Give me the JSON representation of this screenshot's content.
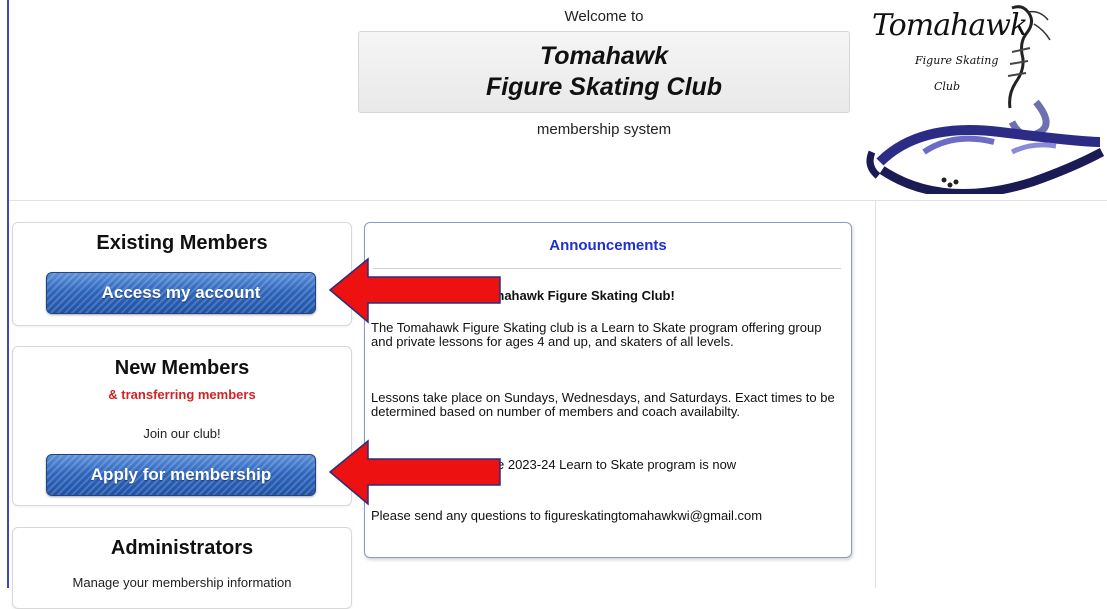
{
  "header": {
    "welcome": "Welcome to",
    "title_line1": "Tomahawk",
    "title_line2": "Figure Skating Club",
    "subtitle": "membership system"
  },
  "logo": {
    "word": "Tomahawk",
    "line2": "Figure Skating",
    "line3": "Club"
  },
  "existing": {
    "heading": "Existing Members",
    "button": "Access my account"
  },
  "new_members": {
    "heading": "New Members",
    "subheading": "& transferring members",
    "text": "Join our club!",
    "button": "Apply for membership"
  },
  "admin": {
    "heading": "Administrators",
    "text": "Manage your membership information"
  },
  "announcements": {
    "title": "Announcements",
    "welcome_line": "e Tomahawk Figure Skating Club!",
    "p1": "The Tomahawk Figure Skating club is a Learn to Skate program offering group and private lessons for ages 4 and up, and skaters of all levels.",
    "p2": "Lessons take place on Sundays, Wednesdays, and Saturdays. Exact times to be determined based on number of members and coach availabilty.",
    "p3": "e 2023-24 Learn to Skate program is now",
    "p4": "Please send any questions to figureskatingtomahawkwi@gmail.com"
  },
  "colors": {
    "arrow": "#ee1111",
    "button_blue": "#2e66bd",
    "announce_title": "#1f2fd0",
    "transfer_red": "#d32222"
  }
}
